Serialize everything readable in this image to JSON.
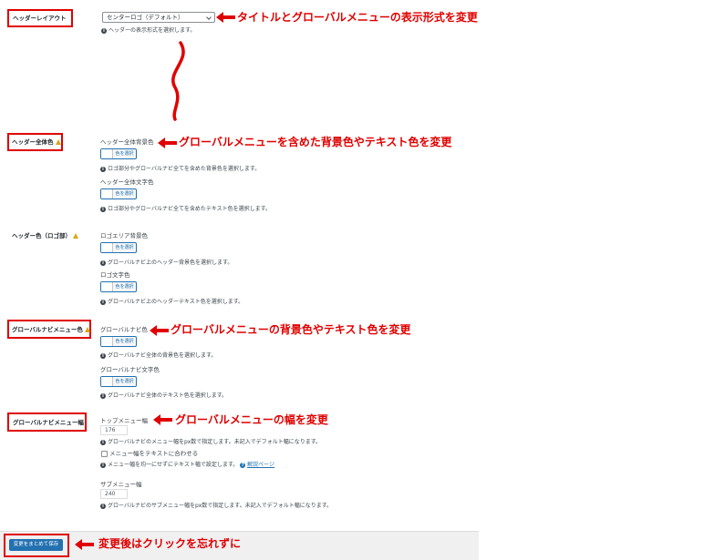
{
  "header_layout": {
    "label": "ヘッダーレイアウト",
    "select_value": "センターロゴ（デフォルト）",
    "help": "ヘッダーの表示形式を選択します。",
    "annotation": "タイトルとグローバルメニューの表示形式を変更"
  },
  "header_overall": {
    "label": "ヘッダー全体色",
    "annotation": "グローバルメニューを含めた背景色やテキスト色を変更",
    "fields": [
      {
        "label": "ヘッダー全体背景色",
        "button": "色を選択",
        "help": "ロゴ部分やグローバルナビ全てを含めた背景色を選択します。"
      },
      {
        "label": "ヘッダー全体文字色",
        "button": "色を選択",
        "help": "ロゴ部分やグローバルナビ全てを含めたテキスト色を選択します。"
      }
    ]
  },
  "header_logo": {
    "label": "ヘッダー色（ロゴ部）",
    "fields": [
      {
        "label": "ロゴエリア背景色",
        "button": "色を選択",
        "help": "グローバルナビ上のヘッダー背景色を選択します。"
      },
      {
        "label": "ロゴ文字色",
        "button": "色を選択",
        "help": "グローバルナビ上のヘッダーテキスト色を選択します。"
      }
    ]
  },
  "global_nav_color": {
    "label": "グローバルナビメニュー色",
    "annotation": "グローバルメニューの背景色やテキスト色を変更",
    "fields": [
      {
        "label": "グローバルナビ色",
        "button": "色を選択",
        "help": "グローバルナビ全体の背景色を選択します。"
      },
      {
        "label": "グローバルナビ文字色",
        "button": "色を選択",
        "help": "グローバルナビ全体のテキスト色を選択します。"
      }
    ]
  },
  "global_nav_width": {
    "label": "グローバルナビメニュー幅",
    "annotation": "グローバルメニューの幅を変更",
    "top_label": "トップメニュー幅",
    "top_value": "176",
    "top_help": "グローバルナビのメニュー幅をpx数で指定します。未記入でデフォルト幅になります。",
    "checkbox_label": "メニュー幅をテキストに合わせる",
    "checkbox_help": "メニュー幅を均一にせずにテキスト幅で設定します。",
    "help_link": "解説ページ",
    "sub_label": "サブメニュー幅",
    "sub_value": "240",
    "sub_help": "グローバルナビのサブメニュー幅をpx数で指定します。未記入でデフォルト幅になります。"
  },
  "footer": {
    "save_button": "変更をまとめて保存",
    "annotation": "変更後はクリックを忘れずに"
  },
  "colors": {
    "accent": "#2271b1",
    "annotation": "#e00000",
    "warning": "#dba617"
  },
  "icons": {
    "info": "i",
    "help": "?"
  }
}
